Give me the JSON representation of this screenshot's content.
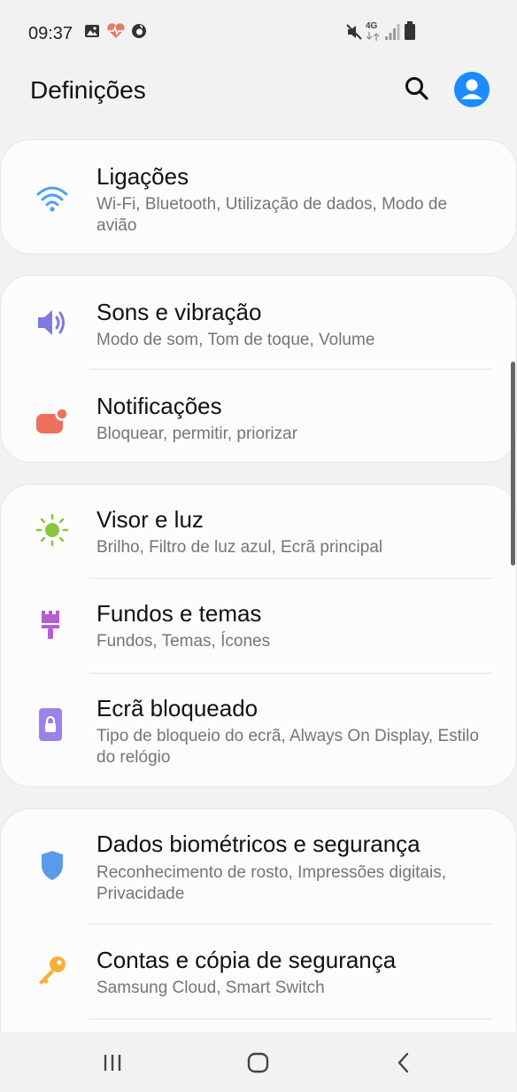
{
  "status_bar": {
    "time": "09:37",
    "network_label": "4G",
    "left_icons": [
      "gallery-icon",
      "health-icon",
      "vodafone-icon"
    ],
    "right_icons": [
      "mute-icon",
      "network-4g-icon",
      "signal-icon",
      "battery-icon"
    ]
  },
  "header": {
    "title": "Definições",
    "actions": [
      "search-icon",
      "account-icon"
    ],
    "accent_color": "#1a8cff"
  },
  "cards": [
    {
      "items": [
        {
          "title": "Ligações",
          "subtitle": "Wi-Fi, Bluetooth, Utilização de dados, Modo de avião",
          "icon": "wifi-icon",
          "color": "#4aa3f0"
        }
      ]
    },
    {
      "items": [
        {
          "title": "Sons e vibração",
          "subtitle": "Modo de som, Tom de toque, Volume",
          "icon": "speaker-icon",
          "color": "#7f7ae0"
        },
        {
          "title": "Notificações",
          "subtitle": "Bloquear, permitir, priorizar",
          "icon": "notification-icon",
          "color": "#ef6f5e"
        }
      ]
    },
    {
      "items": [
        {
          "title": "Visor e luz",
          "subtitle": "Brilho, Filtro de luz azul, Ecrã principal",
          "icon": "sun-icon",
          "color": "#8bc53f"
        },
        {
          "title": "Fundos e temas",
          "subtitle": "Fundos, Temas, Ícones",
          "icon": "paintbrush-icon",
          "color": "#b45ed1"
        },
        {
          "title": "Ecrã bloqueado",
          "subtitle": "Tipo de bloqueio do ecrã, Always On Display, Estilo do relógio",
          "icon": "lock-screen-icon",
          "color": "#9b82e6"
        }
      ]
    },
    {
      "items": [
        {
          "title": "Dados biométricos e segurança",
          "subtitle": "Reconhecimento de rosto, Impressões digitais, Privacidade",
          "icon": "shield-icon",
          "color": "#5a9be8"
        },
        {
          "title": "Contas e cópia de segurança",
          "subtitle": "Samsung Cloud, Smart Switch",
          "icon": "key-icon",
          "color": "#f4b23a"
        }
      ]
    }
  ],
  "nav_bar": {
    "buttons": [
      "recents-icon",
      "home-icon",
      "back-icon"
    ]
  }
}
